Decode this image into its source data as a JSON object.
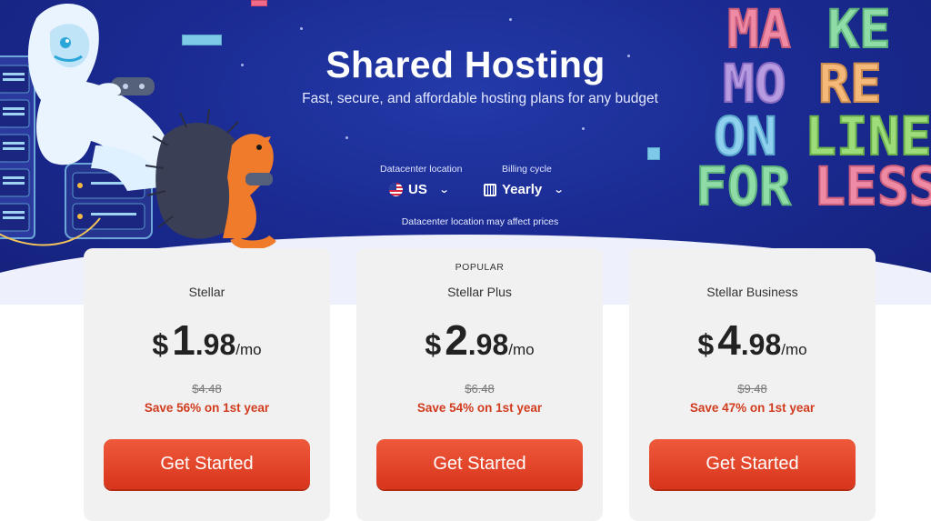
{
  "hero": {
    "title": "Shared Hosting",
    "subtitle": "Fast, secure, and affordable hosting plans for any budget",
    "datacenter_label": "Datacenter location",
    "datacenter_value": "US",
    "billing_label": "Billing cycle",
    "billing_value": "Yearly",
    "note": "Datacenter location may affect prices",
    "illustration_right_text": "MAKE MORE ONLINE FOR LESS"
  },
  "plans": [
    {
      "badge": "",
      "name": "Stellar",
      "currency": "$",
      "price_int": "1",
      "price_dec": ".98",
      "period": "/mo",
      "original_price": "$4.48",
      "savings": "Save 56% on 1st year",
      "cta": "Get Started"
    },
    {
      "badge": "POPULAR",
      "name": "Stellar Plus",
      "currency": "$",
      "price_int": "2",
      "price_dec": ".98",
      "period": "/mo",
      "original_price": "$6.48",
      "savings": "Save 54% on 1st year",
      "cta": "Get Started"
    },
    {
      "badge": "",
      "name": "Stellar Business",
      "currency": "$",
      "price_int": "4",
      "price_dec": ".98",
      "period": "/mo",
      "original_price": "$9.48",
      "savings": "Save 47% on 1st year",
      "cta": "Get Started"
    }
  ],
  "colors": {
    "hero_bg": "#1b2b93",
    "cta": "#e2452a",
    "savings_text": "#d23c1e",
    "card_bg": "#f1f1f1"
  }
}
